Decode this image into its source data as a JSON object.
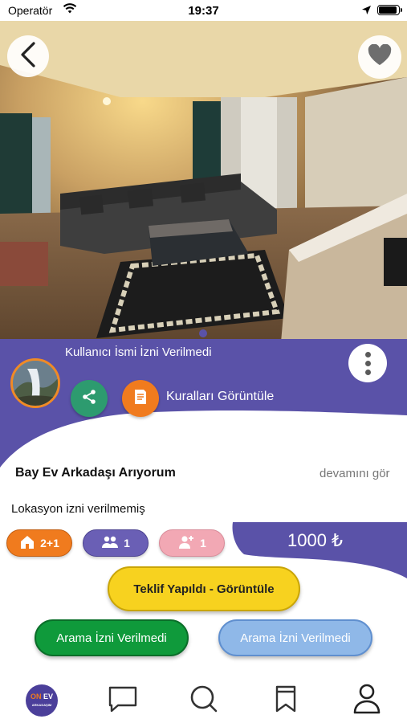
{
  "status_bar": {
    "carrier": "Operatör",
    "time": "19:37"
  },
  "listing": {
    "username": "Kullanıcı İsmi İzni Verilmedi",
    "rules_label": "Kuralları Görüntüle",
    "title": "Bay Ev Arkadaşı Arıyorum",
    "more_link": "devamını gör",
    "location": "Lokasyon izni verilmemiş",
    "rooms": "2+1",
    "residents": "1",
    "wanted": "1",
    "price": "1000 ₺"
  },
  "actions": {
    "offer": "Teklif Yapıldı - Görüntüle",
    "call": "Arama İzni Verilmedi",
    "message": "Arama İzni Verilmedi"
  },
  "tabbar": {
    "logo_top": "ON",
    "logo_main": "EV",
    "logo_sub": "ARKADAŞIM",
    "items": [
      "home-logo",
      "chat-icon",
      "search-icon",
      "bookmark-icon",
      "profile-icon"
    ]
  },
  "colors": {
    "purple": "#5a52a8",
    "orange": "#f07b1e",
    "green": "#2d9b6f",
    "yellow": "#f7d21f",
    "call_green": "#0f9a3b",
    "light_blue": "#8fb8e8"
  }
}
